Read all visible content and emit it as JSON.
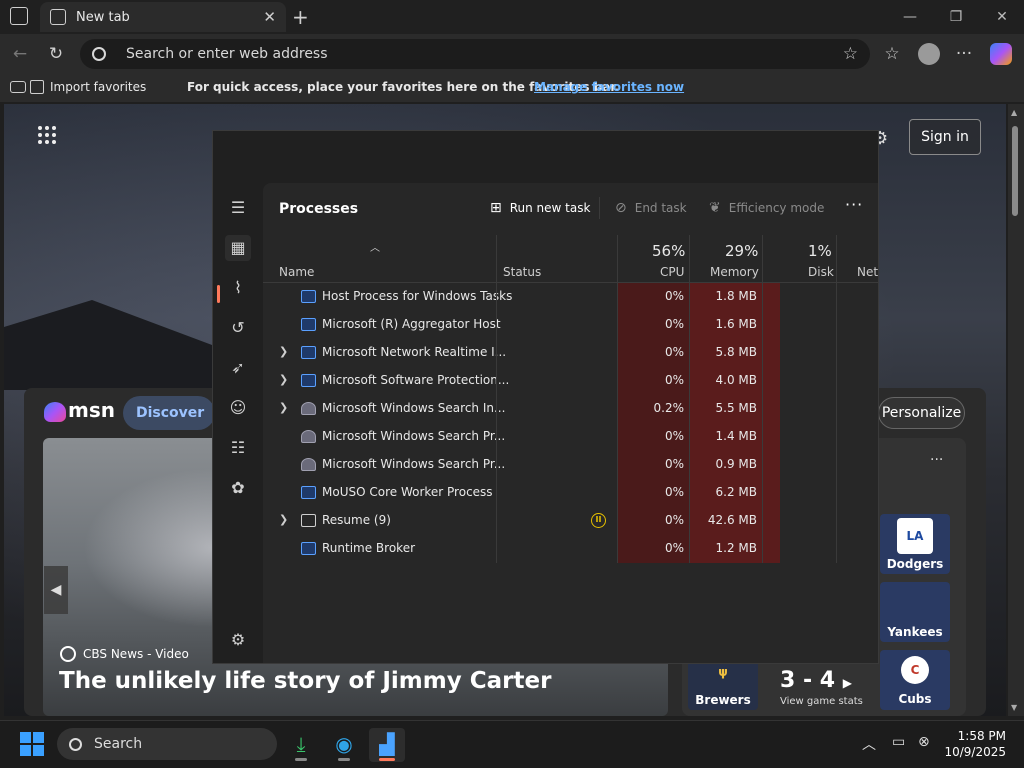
{
  "browser": {
    "tab_title": "New tab",
    "address_placeholder": "Search or enter web address",
    "favbar": {
      "import_label": "Import favorites",
      "message": "For quick access, place your favorites here on the favorites bar.",
      "manage_link": "Manage favorites now"
    }
  },
  "msn": {
    "logo_text": "msn",
    "discover_label": "Discover",
    "signin_label": "Sign in",
    "personalize_label": "Personalize",
    "hero": {
      "source": "CBS News - Video",
      "title": "The unlikely life story of Jimmy Carter"
    },
    "sports": {
      "more_label": "···",
      "teams": [
        "Dodgers",
        "Yankees",
        "Brewers",
        "Cubs"
      ],
      "score": "3 - 4",
      "score_link": "View game stats"
    }
  },
  "taskmanager": {
    "page_title": "Processes",
    "commands": {
      "run_new_task": "Run new task",
      "end_task": "End task",
      "efficiency_mode": "Efficiency mode",
      "more": "···"
    },
    "columns": {
      "name": "Name",
      "status": "Status",
      "cpu_pct": "56%",
      "cpu": "CPU",
      "memory_pct": "29%",
      "memory": "Memory",
      "disk_pct": "1%",
      "disk": "Disk",
      "network": "Netw"
    },
    "rows": [
      {
        "name": "Host Process for Windows Tasks",
        "expandable": false,
        "icon": "app",
        "status": "",
        "cpu": "0%",
        "memory": "1.8 MB"
      },
      {
        "name": "Microsoft (R) Aggregator Host",
        "expandable": false,
        "icon": "app",
        "status": "",
        "cpu": "0%",
        "memory": "1.6 MB"
      },
      {
        "name": "Microsoft Network Realtime I...",
        "expandable": true,
        "icon": "app",
        "status": "",
        "cpu": "0%",
        "memory": "5.8 MB"
      },
      {
        "name": "Microsoft Software Protection...",
        "expandable": true,
        "icon": "app",
        "status": "",
        "cpu": "0%",
        "memory": "4.0 MB"
      },
      {
        "name": "Microsoft Windows Search In...",
        "expandable": true,
        "icon": "search",
        "status": "",
        "cpu": "0.2%",
        "memory": "5.5 MB"
      },
      {
        "name": "Microsoft Windows Search Pr...",
        "expandable": false,
        "icon": "search",
        "status": "",
        "cpu": "0%",
        "memory": "1.4 MB"
      },
      {
        "name": "Microsoft Windows Search Pr...",
        "expandable": false,
        "icon": "search",
        "status": "",
        "cpu": "0%",
        "memory": "0.9 MB"
      },
      {
        "name": "MoUSO Core Worker Process",
        "expandable": false,
        "icon": "app",
        "status": "",
        "cpu": "0%",
        "memory": "6.2 MB"
      },
      {
        "name": "Resume (9)",
        "expandable": true,
        "icon": "resume",
        "status": "paused",
        "cpu": "0%",
        "memory": "42.6 MB"
      },
      {
        "name": "Runtime Broker",
        "expandable": false,
        "icon": "app",
        "status": "",
        "cpu": "0%",
        "memory": "1.2 MB"
      }
    ]
  },
  "taskbar": {
    "search_label": "Search",
    "time": "1:58 PM",
    "date": "10/9/2025"
  },
  "colors": {
    "accent": "#ff7a5c",
    "cpu_heat": "#4a1a1a",
    "mem_heat": "#5a1c1c",
    "link": "#6ab4ff"
  }
}
